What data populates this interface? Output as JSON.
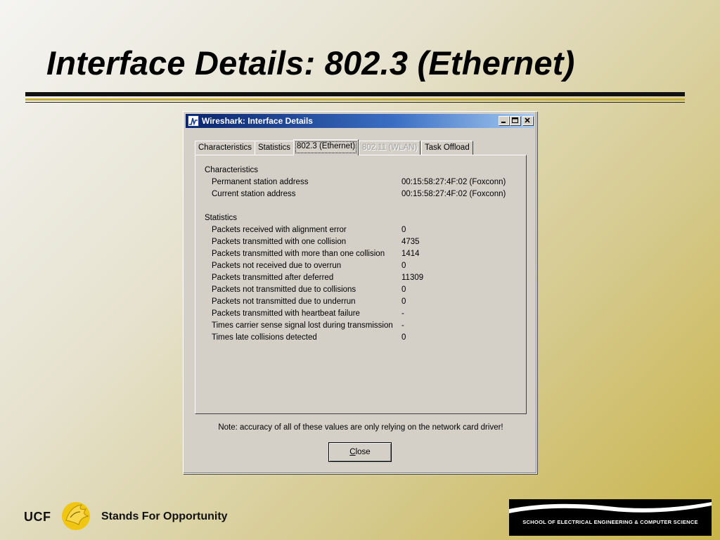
{
  "slide": {
    "title": "Interface Details: 802.3 (Ethernet)"
  },
  "window": {
    "title": "Wireshark: Interface Details",
    "tabs": [
      {
        "label": "Characteristics",
        "state": "normal"
      },
      {
        "label": "Statistics",
        "state": "normal"
      },
      {
        "label": "802.3 (Ethernet)",
        "state": "active"
      },
      {
        "label": "802.11 (WLAN)",
        "state": "disabled"
      },
      {
        "label": "Task Offload",
        "state": "normal"
      }
    ],
    "characteristics": {
      "heading": "Characteristics",
      "rows": [
        {
          "label": "Permanent station address",
          "value": "00:15:58:27:4F:02 (Foxconn)"
        },
        {
          "label": "Current station address",
          "value": "00:15:58:27:4F:02 (Foxconn)"
        }
      ]
    },
    "statistics": {
      "heading": "Statistics",
      "rows": [
        {
          "label": "Packets received with alignment error",
          "value": "0"
        },
        {
          "label": "Packets transmitted with one collision",
          "value": "4735"
        },
        {
          "label": "Packets transmitted with more than one collision",
          "value": "1414"
        },
        {
          "label": "Packets not received due to overrun",
          "value": "0"
        },
        {
          "label": "Packets transmitted after deferred",
          "value": "11309"
        },
        {
          "label": "Packets not transmitted due to collisions",
          "value": "0"
        },
        {
          "label": "Packets not transmitted due to underrun",
          "value": "0"
        },
        {
          "label": "Packets transmitted with heartbeat failure",
          "value": "-"
        },
        {
          "label": "Times carrier sense signal lost during transmission",
          "value": "-"
        },
        {
          "label": "Times late collisions detected",
          "value": "0"
        }
      ]
    },
    "note": "Note: accuracy of all of these values are only relying on the network card driver!",
    "close_button": {
      "mnemonic": "C",
      "rest": "lose"
    }
  },
  "footer": {
    "ucf": "UCF",
    "tagline": "Stands For Opportunity",
    "school": "SCHOOL OF ELECTRICAL ENGINEERING & COMPUTER SCIENCE"
  },
  "colors": {
    "titlebar_start": "#0a246a",
    "titlebar_end": "#a6caf0",
    "gold_rule": "#c9ae35",
    "window_face": "#d4d0c8"
  },
  "icons": [
    "wireshark-app-icon",
    "minimize-icon",
    "maximize-icon",
    "close-icon",
    "pegasus-logo-icon"
  ]
}
